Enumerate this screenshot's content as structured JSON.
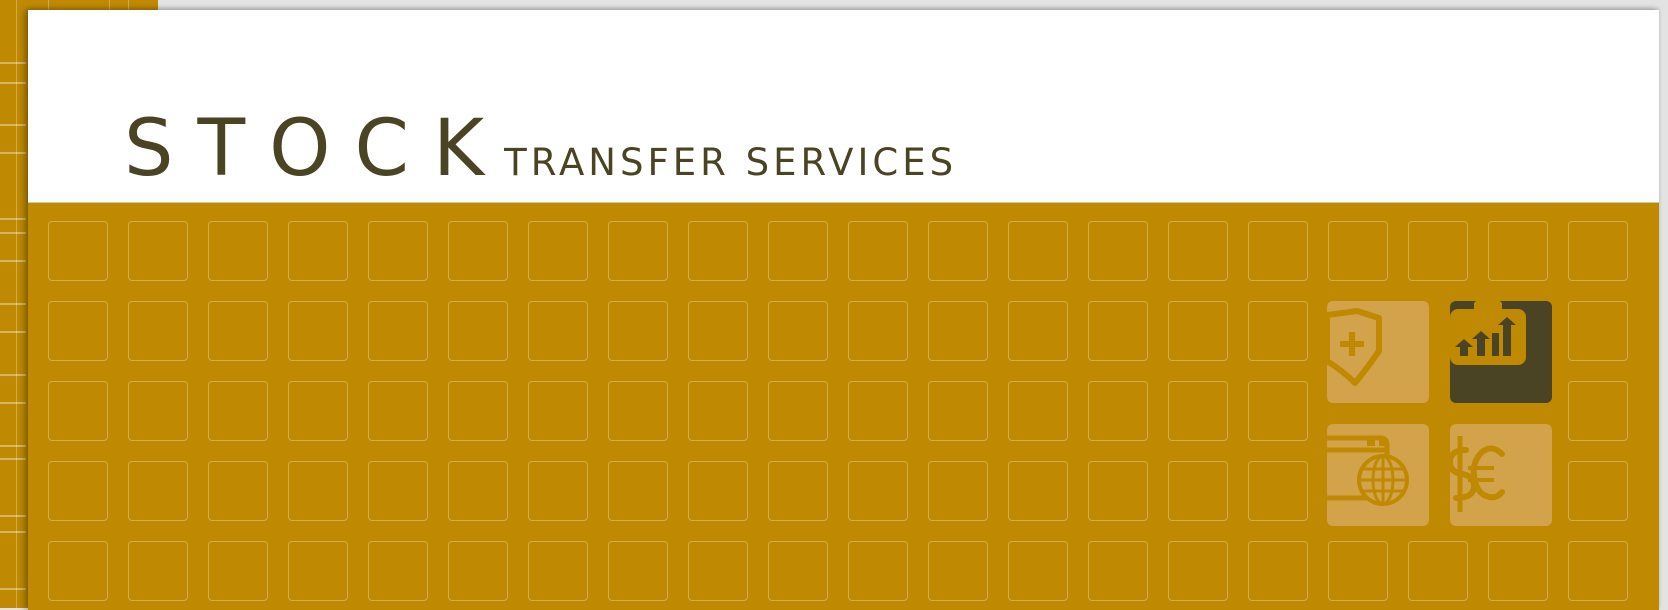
{
  "brand": {
    "main": "STOCK",
    "sub": "TRANSFER SERVICES"
  },
  "colors": {
    "gold": "#bf8a02",
    "tile_light": "#d3a34c",
    "tile_dark": "#4a4424",
    "text_dark": "#4a4424",
    "header_bg": "#ffffff"
  },
  "tiles": [
    {
      "icon": "shield-plus-icon",
      "style": "light"
    },
    {
      "icon": "chart-arrows-icon",
      "style": "dark"
    },
    {
      "icon": "browser-globe-icon",
      "style": "light"
    },
    {
      "icon": "currency-icon",
      "style": "light"
    }
  ]
}
